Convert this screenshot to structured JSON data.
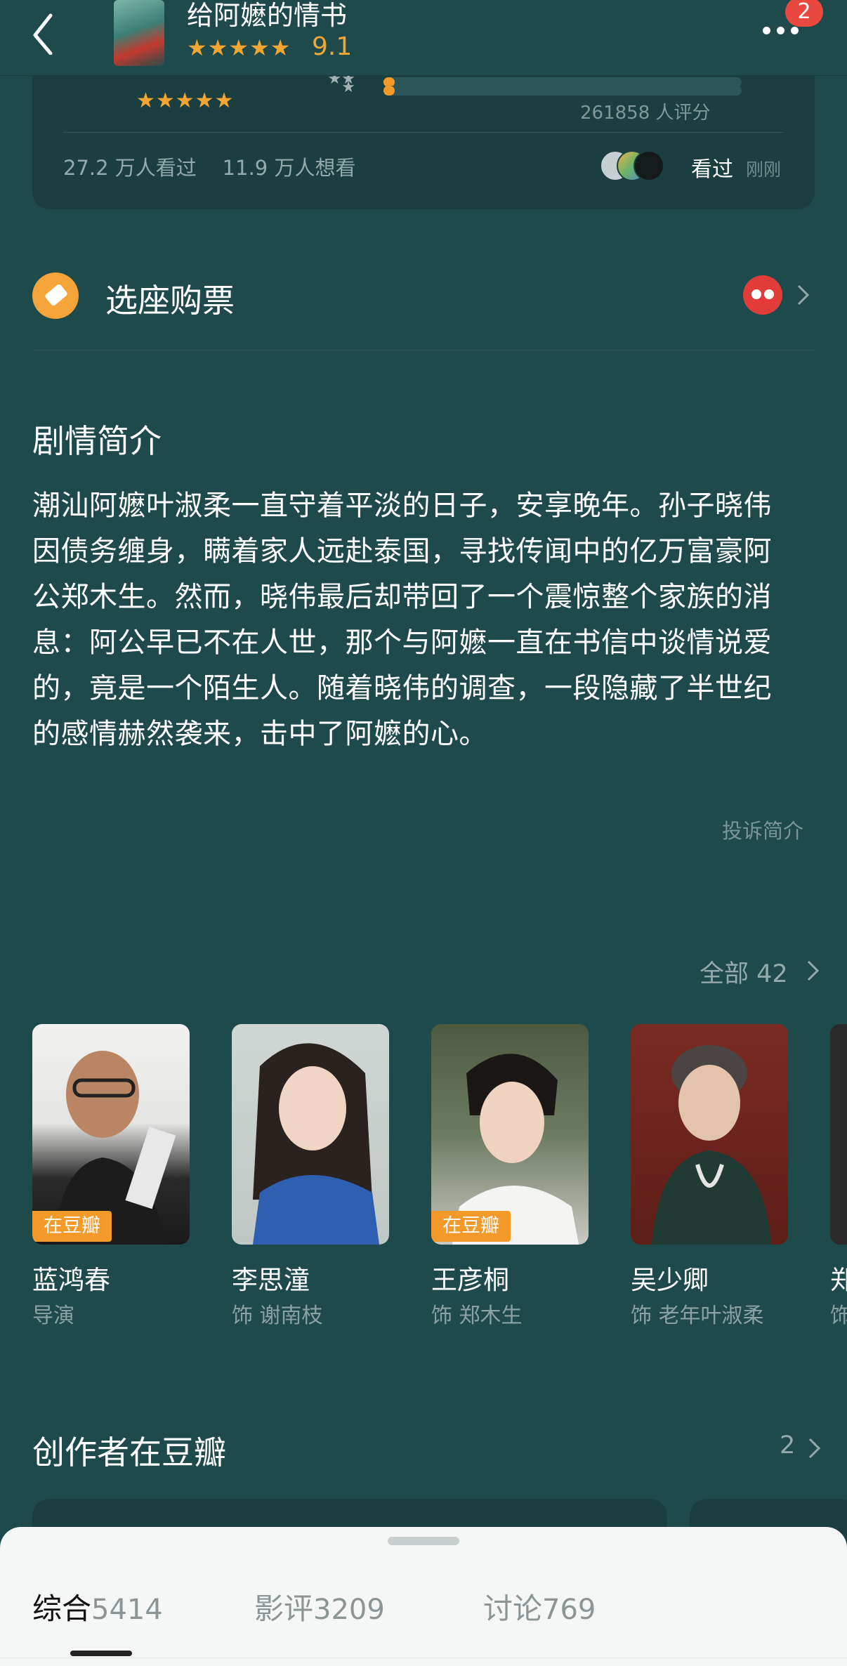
{
  "nav": {
    "title": "给阿嬷的情书",
    "stars": "★★★★★",
    "score": "9.1",
    "badge": "2"
  },
  "rating": {
    "stars": "★★★★★",
    "count_text": "261858 人评分",
    "seen_text": "27.2 万人看过",
    "want_text": "11.9 万人想看",
    "seen_label": "看过",
    "time_label": "刚刚"
  },
  "tickets": {
    "label": "选座购票"
  },
  "synopsis": {
    "title": "剧情简介",
    "text": "潮汕阿嬷叶淑柔一直守着平淡的日子，安享晚年。孙子晓伟因债务缠身，瞒着家人远赴泰国，寻找传闻中的亿万富豪阿公郑木生。然而，晓伟最后却带回了一个震惊整个家族的消息：阿公早已不在人世，那个与阿嬷一直在书信中谈情说爱的，竟是一个陌生人。随着晓伟的调查，一段隐藏了半世纪的感情赫然袭来，击中了阿嬷的心。",
    "report": "投诉简介"
  },
  "cast": {
    "all_label": "全部 42",
    "members": [
      {
        "name": "蓝鸿春",
        "role": "导演",
        "tag": "在豆瓣"
      },
      {
        "name": "李思潼",
        "role": "饰 谢南枝",
        "tag": ""
      },
      {
        "name": "王彦桐",
        "role": "饰 郑木生",
        "tag": "在豆瓣"
      },
      {
        "name": "吴少卿",
        "role": "饰 老年叶淑柔",
        "tag": ""
      },
      {
        "name": "郑",
        "role": "饰",
        "tag": ""
      }
    ]
  },
  "creators": {
    "title": "创作者在豆瓣",
    "count": "2"
  },
  "tabs": [
    {
      "label": "综合",
      "count": "5414",
      "active": true
    },
    {
      "label": "影评",
      "count": "3209",
      "active": false
    },
    {
      "label": "讨论",
      "count": "769",
      "active": false
    }
  ],
  "colors": {
    "background": "#1f4a4c",
    "card": "#1b3f41",
    "accent": "#f39a2b",
    "sheet": "#f5f7f7"
  }
}
